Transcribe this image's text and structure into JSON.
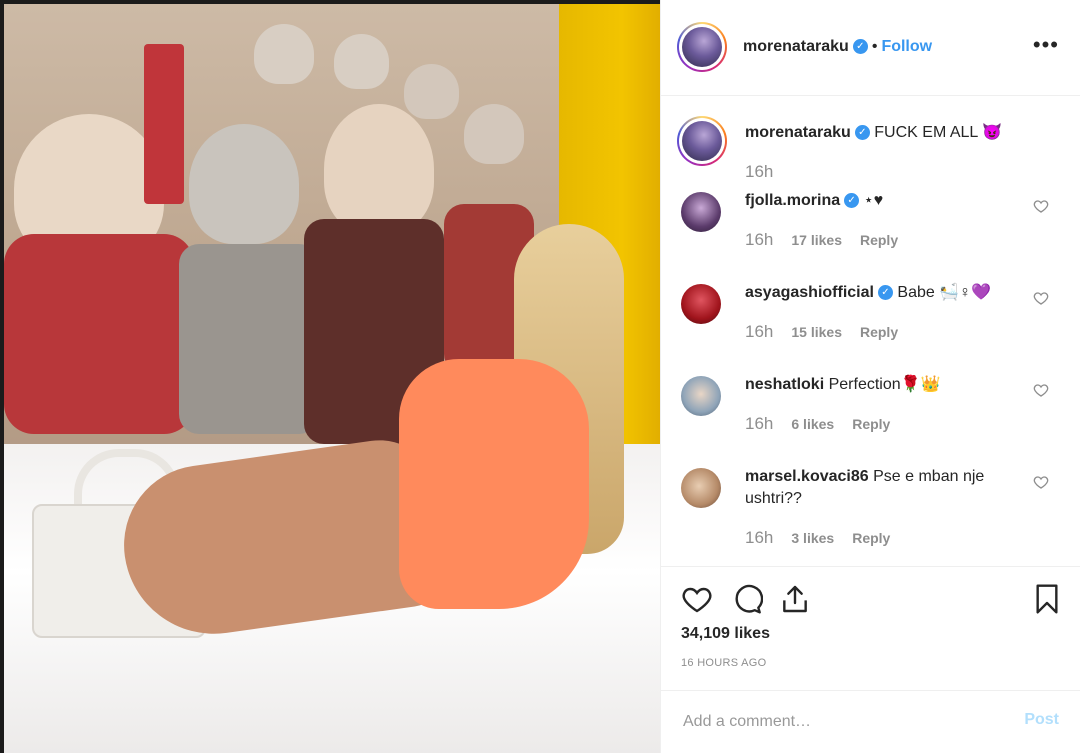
{
  "post": {
    "author": "morenataraku",
    "follow_label": "Follow",
    "dot": "•",
    "more_label": "•••"
  },
  "caption": {
    "username": "morenataraku",
    "text": "FUCK EM ALL 😈",
    "time": "16h"
  },
  "comments": [
    {
      "username": "fjolla.morina",
      "verified": true,
      "text": "⋆♥",
      "time": "16h",
      "likes": "17 likes",
      "reply": "Reply",
      "avatar_color": "#5b3b6b"
    },
    {
      "username": "asyagashiofficial",
      "verified": true,
      "text": "Babe 🛀♀💜",
      "time": "16h",
      "likes": "15 likes",
      "reply": "Reply",
      "avatar_color": "#a0141c"
    },
    {
      "username": "neshatloki",
      "verified": false,
      "text": "Perfection🌹👑",
      "time": "16h",
      "likes": "6 likes",
      "reply": "Reply",
      "avatar_color": "#8fa4b8"
    },
    {
      "username": "marsel.kovaci86",
      "verified": false,
      "text": "Pse e mban nje ushtri??",
      "time": "16h",
      "likes": "3 likes",
      "reply": "Reply",
      "avatar_color": "#b58a68"
    }
  ],
  "stats": {
    "likes": "34,109 likes",
    "ago": "16 HOURS AGO"
  },
  "composer": {
    "placeholder": "Add a comment…",
    "post_label": "Post"
  },
  "colors": {
    "accent": "#3897f0",
    "muted": "#8e8e8e",
    "post_disabled": "#b2dffc"
  }
}
